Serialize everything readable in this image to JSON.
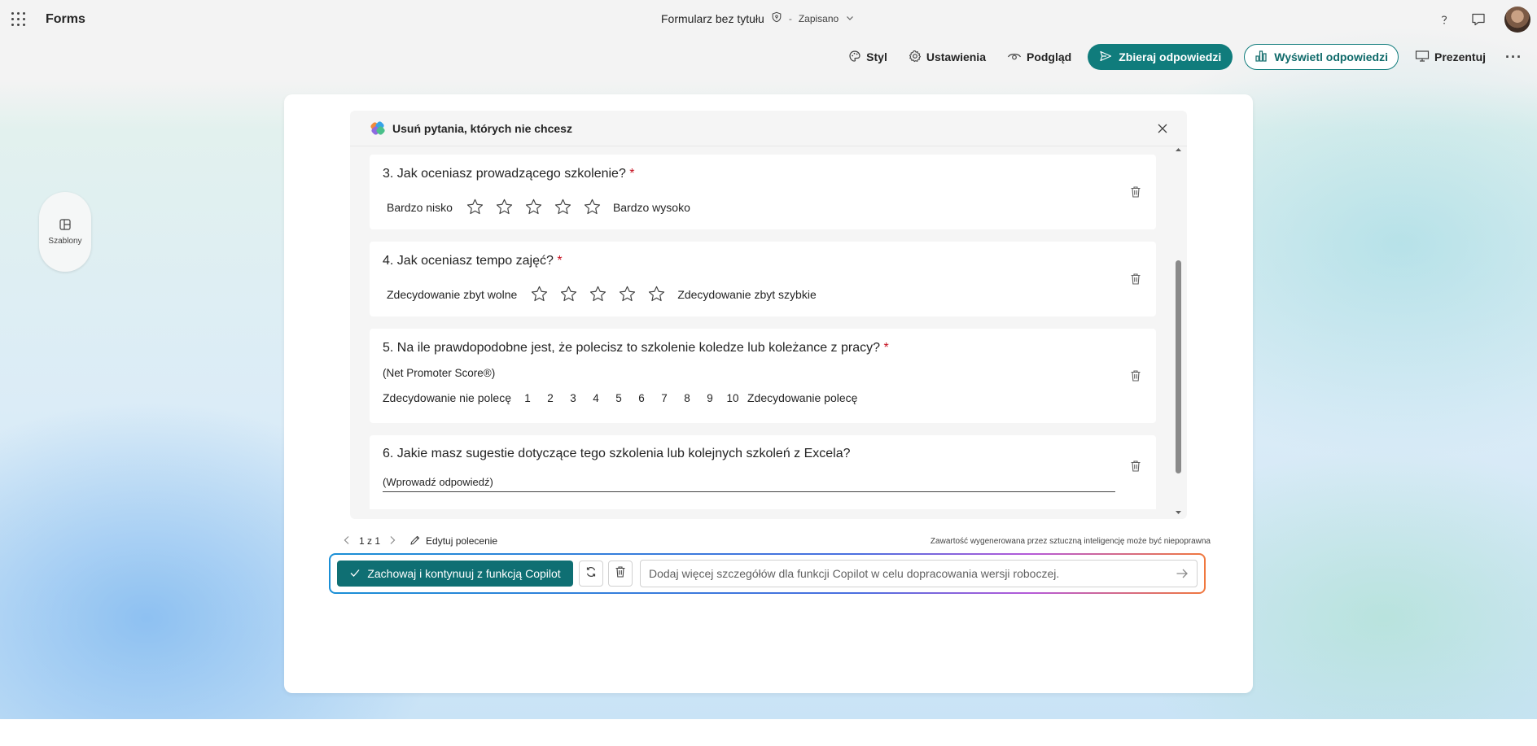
{
  "app": {
    "name": "Forms"
  },
  "document": {
    "title": "Formularz bez tytułu",
    "separator": "-",
    "save_status": "Zapisano"
  },
  "toolbar": {
    "style_label": "Styl",
    "settings_label": "Ustawienia",
    "preview_label": "Podgląd",
    "collect_label": "Zbieraj odpowiedzi",
    "view_responses_label": "Wyświetl odpowiedzi",
    "present_label": "Prezentuj",
    "more_label": "···"
  },
  "colors": {
    "accent": "#107c7c",
    "required": "#c50f1f"
  },
  "sidebar": {
    "templates_label": "Szablony"
  },
  "copilot_panel": {
    "header": "Usuń pytania, których nie chcesz",
    "questions": [
      {
        "title": "3. Jak oceniasz prowadzącego szkolenie?",
        "required": "*",
        "low_label": "Bardzo nisko",
        "high_label": "Bardzo wysoko",
        "stars": 5
      },
      {
        "title": "4. Jak oceniasz tempo zajęć?",
        "required": "*",
        "low_label": "Zdecydowanie zbyt wolne",
        "high_label": "Zdecydowanie zbyt szybkie",
        "stars": 5
      },
      {
        "title": "5. Na ile prawdopodobne jest, że polecisz to szkolenie koledze lub koleżance z pracy?",
        "required": "*",
        "subtitle": "(Net Promoter Score®)",
        "low_label": "Zdecydowanie nie polecę",
        "high_label": "Zdecydowanie polecę",
        "scale": [
          "1",
          "2",
          "3",
          "4",
          "5",
          "6",
          "7",
          "8",
          "9",
          "10"
        ]
      },
      {
        "title": "6. Jakie masz sugestie dotyczące tego szkolenia lub kolejnych szkoleń z Excela?",
        "placeholder": "(Wprowadź odpowiedź)"
      }
    ]
  },
  "footer": {
    "pager": "1 z 1",
    "edit_prompt": "Edytuj polecenie",
    "disclaimer": "Zawartość wygenerowana przez sztuczną inteligencję może być niepoprawna"
  },
  "copilot_bar": {
    "keep_label": "Zachowaj i kontynuuj z funkcją Copilot",
    "input_placeholder": "Dodaj więcej szczegółów dla funkcji Copilot w celu dopracowania wersji roboczej."
  }
}
